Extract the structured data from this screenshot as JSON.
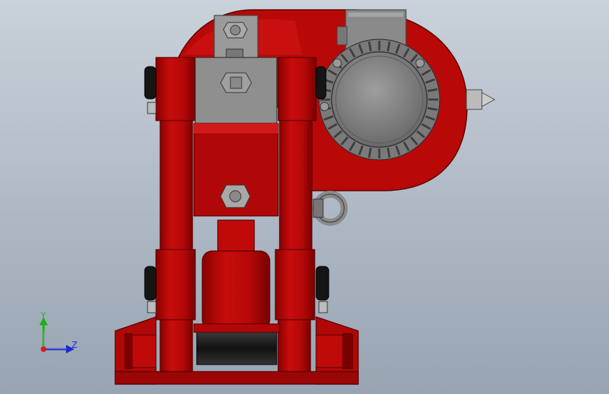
{
  "viewport": {
    "background_top": "#c9d1da",
    "background_bottom": "#98a4b2"
  },
  "model": {
    "body_color": "#c00a0a",
    "body_dark": "#8a0000",
    "body_light": "#de2a2a",
    "motor_color": "#8c8c8c",
    "motor_dark": "#5e5e5e",
    "rubber_color": "#1e1e1e"
  },
  "triad": {
    "y_label": "Y",
    "z_label": "Z",
    "y_color": "#1bb21b",
    "z_color": "#1a2bd4",
    "x_color": "#d81b1b"
  }
}
